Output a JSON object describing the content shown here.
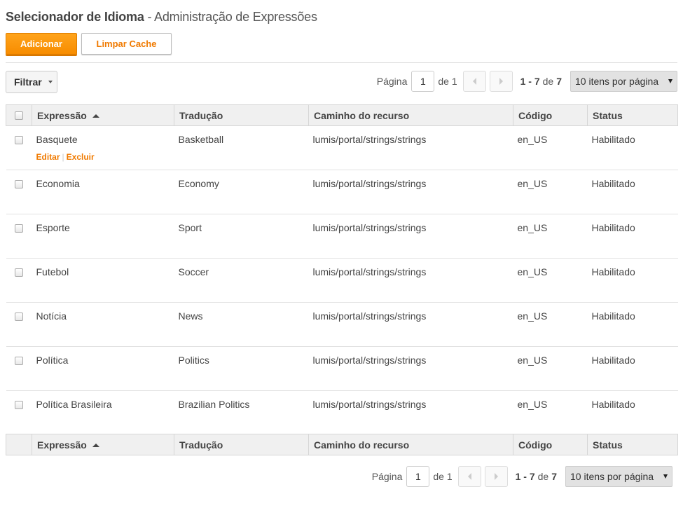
{
  "header": {
    "title_strong": "Selecionador de Idioma",
    "title_rest": " - Administração de Expressões"
  },
  "toolbar": {
    "add_label": "Adicionar",
    "clear_cache_label": "Limpar Cache",
    "filter_label": "Filtrar"
  },
  "pagination": {
    "page_label": "Página",
    "current_page": "1",
    "of_label": "de 1",
    "range": "1 - 7",
    "range_of": "de",
    "total": "7",
    "per_page": "10 itens por página"
  },
  "table": {
    "columns": [
      "Expressão",
      "Tradução",
      "Caminho do recurso",
      "Código",
      "Status"
    ],
    "row_actions": {
      "edit": "Editar",
      "separator": "|",
      "delete": "Excluir"
    },
    "rows": [
      {
        "expression": "Basquete",
        "translation": "Basketball",
        "path": "lumis/portal/strings/strings",
        "code": "en_US",
        "status": "Habilitado"
      },
      {
        "expression": "Economia",
        "translation": "Economy",
        "path": "lumis/portal/strings/strings",
        "code": "en_US",
        "status": "Habilitado"
      },
      {
        "expression": "Esporte",
        "translation": "Sport",
        "path": "lumis/portal/strings/strings",
        "code": "en_US",
        "status": "Habilitado"
      },
      {
        "expression": "Futebol",
        "translation": "Soccer",
        "path": "lumis/portal/strings/strings",
        "code": "en_US",
        "status": "Habilitado"
      },
      {
        "expression": "Notícia",
        "translation": "News",
        "path": "lumis/portal/strings/strings",
        "code": "en_US",
        "status": "Habilitado"
      },
      {
        "expression": "Política",
        "translation": "Politics",
        "path": "lumis/portal/strings/strings",
        "code": "en_US",
        "status": "Habilitado"
      },
      {
        "expression": "Política Brasileira",
        "translation": "Brazilian Politics",
        "path": "lumis/portal/strings/strings",
        "code": "en_US",
        "status": "Habilitado"
      }
    ]
  },
  "colors": {
    "accent": "#f78c00",
    "link": "#f07a00"
  }
}
